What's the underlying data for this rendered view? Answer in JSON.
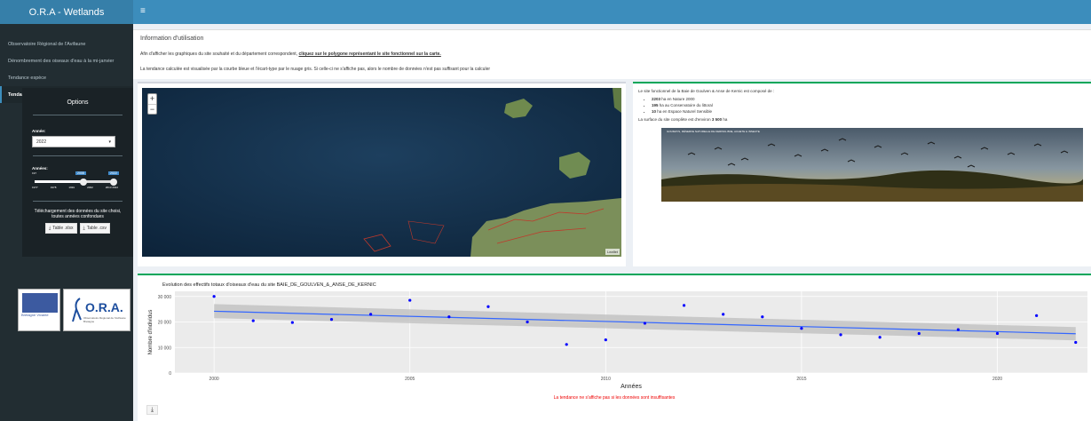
{
  "app": {
    "title": "O.R.A - Wetlands",
    "menu_icon": "hamburger-icon"
  },
  "sidebar": {
    "items": [
      {
        "label": "Observatoire Régional de l'Avifaune"
      },
      {
        "label": "Dénombrement des oiseaux d'eau à la mi-janvier"
      },
      {
        "label": "Tendance espèce"
      },
      {
        "label": "Tendance site"
      }
    ]
  },
  "options": {
    "title": "Options",
    "year_label": "Année:",
    "year_value": "2022",
    "years_label": "Années:",
    "slider": {
      "min": "197",
      "handle_low": "2008",
      "handle_high": "2022",
      "ticks": [
        "1977",
        "1978",
        "1991",
        "2002",
        "2013 2022"
      ]
    },
    "download_text": "Téléchargement des données du site choisi, toutes années confondues",
    "btn_xlsx": "Table .xlsx",
    "btn_csv": "Table .csv"
  },
  "logos": {
    "bv_text": "Bretagne Vivante",
    "ora_text": "O.R.A.",
    "ora_sub": "Observatoire Régional de l'Avifaune Bretagne"
  },
  "info": {
    "title": "Information d'utilisation",
    "p1_a": "Afin d'afficher les graphiques du site souhaité et du département correspondent, ",
    "p1_b": "cliquez sur le polygone représentant le site fonctionnel sur la carte.",
    "p2": "La tendance calculée est visualisée par la courbe bleue et l'écart-type par le nuage gris. Si celle-ci ne s'affiche pas, alors le nombre de données n'est pas suffisant pour la calculer"
  },
  "map": {
    "attribution": "Leaflet"
  },
  "site": {
    "intro": "Le site fonctionnel de la Baie de Goulven & Anse de Kernic est composé de :",
    "items": [
      {
        "value": "2203",
        "text": " ha en Nature 2000"
      },
      {
        "value": "195",
        "text": " ha au Conservatoire du littoral"
      },
      {
        "value": "10",
        "text": " ha en Espace Naturel Sensible"
      }
    ],
    "surface_a": "La surface du site complète est d'environ ",
    "surface_b": "3 500",
    "surface_c": " ha",
    "photo_caption": "GOUMAYS, RÉSERVE NATURELLE DE KERPAIL BNE, ACHETE & INSECTE"
  },
  "chart": {
    "title": "Evolution des effectifs totaux d'oiseaux d'eau du site BAIE_DE_GOULVEN_&_ANSE_DE_KERNIC",
    "note": "La tendance ne s'affiche pas si les données sont insuffisantes"
  },
  "chart_data": {
    "type": "scatter",
    "title": "Evolution des effectifs totaux d'oiseaux d'eau du site BAIE_DE_GOULVEN_&_ANSE_DE_KERNIC",
    "xlabel": "Années",
    "ylabel": "Nombre d'individus",
    "xlim": [
      1999,
      2022.3
    ],
    "ylim": [
      0,
      32000
    ],
    "x_ticks": [
      2000,
      2005,
      2010,
      2015,
      2020
    ],
    "y_ticks": [
      0,
      10000,
      20000,
      30000
    ],
    "y_tick_labels": [
      "0",
      "10 000",
      "20 000",
      "30 000"
    ],
    "x": [
      2000,
      2001,
      2002,
      2003,
      2004,
      2005,
      2006,
      2007,
      2008,
      2009,
      2010,
      2011,
      2012,
      2013,
      2014,
      2015,
      2016,
      2017,
      2018,
      2019,
      2020,
      2021,
      2022
    ],
    "y": [
      30000,
      20500,
      19800,
      21000,
      23000,
      28500,
      22000,
      26000,
      20000,
      11200,
      13000,
      19500,
      26500,
      23000,
      22000,
      17500,
      15000,
      14000,
      15500,
      17000,
      15500,
      22500,
      12000
    ],
    "trend": {
      "x": [
        2000,
        2022
      ],
      "y": [
        24200,
        15400
      ],
      "band_low": [
        21500,
        12800
      ],
      "band_high": [
        27000,
        18000
      ]
    },
    "point_color": "#0000ff",
    "trend_color": "#3366ff",
    "band_color": "#bdbdbd",
    "grid": true
  }
}
